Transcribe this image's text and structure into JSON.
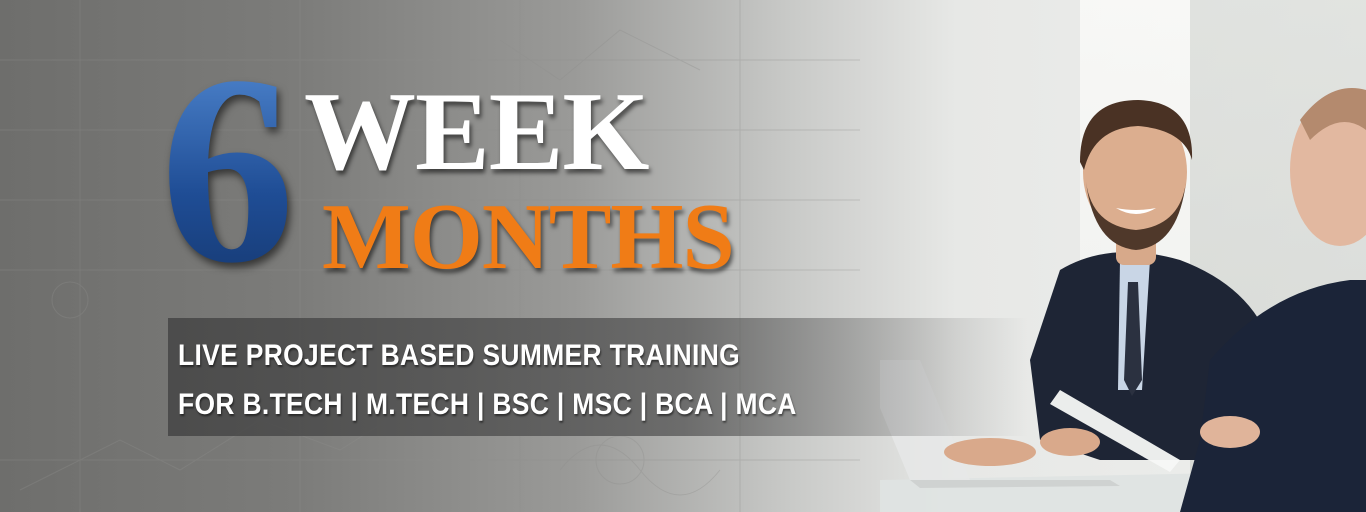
{
  "banner": {
    "digit": "6",
    "word_week": "WEEK",
    "word_months": "MONTHS",
    "tagline_line1": "LIVE PROJECT BASED SUMMER TRAINING",
    "tagline_line2": "FOR B.TECH | M.TECH | BSC | MSC | BCA | MCA"
  },
  "colors": {
    "digit": "#2a5fa8",
    "week": "#ffffff",
    "months": "#f07c16",
    "tagline": "#ffffff"
  },
  "image": {
    "subject": "two-businessmen-meeting-photo"
  }
}
